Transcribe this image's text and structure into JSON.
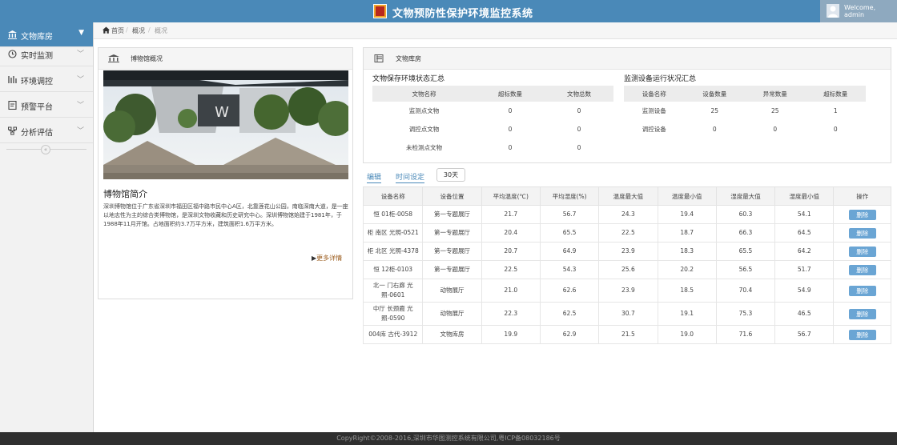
{
  "header": {
    "logo_icon": "museum-logo",
    "title": "文物预防性保护环境监控系统",
    "user_icon": "user-avatar-icon",
    "welcome": "Welcome,",
    "username": "admin"
  },
  "sidebar": {
    "items": [
      {
        "label": "文物库房",
        "icon": "bank-icon",
        "active": true
      },
      {
        "label": "实时监测",
        "icon": "clock-icon",
        "active": false
      },
      {
        "label": "环境调控",
        "icon": "bars-icon",
        "active": false
      },
      {
        "label": "预警平台",
        "icon": "document-icon",
        "active": false
      },
      {
        "label": "分析评估",
        "icon": "network-icon",
        "active": false
      }
    ]
  },
  "breadcrumb": {
    "home": "首页",
    "level1": "概况",
    "level2": "概况"
  },
  "museum_panel": {
    "title": "博物馆概况",
    "intro_title": "博物馆简介",
    "intro_text": "深圳博物馆位于广东省深圳市福田区福中路市民中心A区，北靠莲花山公园，南临深南大道，是一座以地志性为主的综合类博物馆，是深圳文物收藏和历史研究中心。深圳博物馆始建于1981年，于1988年11月开馆。占地面积约3.7万平方米，建筑面积1.6万平方米。",
    "more": "更多详情"
  },
  "storage_panel": {
    "title": "文物库房",
    "env_summary": {
      "title": "文物保存环境状态汇总",
      "headers": [
        "文物名称",
        "超标数量",
        "文物总数"
      ],
      "rows": [
        [
          "监测点文物",
          "0",
          "0"
        ],
        [
          "调控点文物",
          "0",
          "0"
        ],
        [
          "未检测点文物",
          "0",
          "0"
        ]
      ]
    },
    "device_summary": {
      "title": "监测设备运行状况汇总",
      "headers": [
        "设备名称",
        "设备数量",
        "异常数量",
        "超标数量"
      ],
      "rows": [
        [
          "监测设备",
          "25",
          "25",
          "1"
        ],
        [
          "调控设备",
          "0",
          "0",
          "0"
        ]
      ]
    }
  },
  "tabs": {
    "edit": "编辑",
    "time_setting": "时间设定",
    "days": "30天"
  },
  "devices_table": {
    "headers": [
      "设备名称",
      "设备位置",
      "平均温度(℃)",
      "平均湿度(%)",
      "温度最大值",
      "温度最小值",
      "湿度最大值",
      "湿度最小值",
      "操作"
    ],
    "delete_label": "删除",
    "rows": [
      [
        "恒 01柜-0058",
        "第一专题展厅",
        "21.7",
        "56.7",
        "24.3",
        "19.4",
        "60.3",
        "54.1"
      ],
      [
        "柜 南区 光照-0521",
        "第一专题展厅",
        "20.4",
        "65.5",
        "22.5",
        "18.7",
        "66.3",
        "64.5"
      ],
      [
        "柜 北区 光照-4378",
        "第一专题展厅",
        "20.7",
        "64.9",
        "23.9",
        "18.3",
        "65.5",
        "64.2"
      ],
      [
        "恒 12柜-0103",
        "第一专题展厅",
        "22.5",
        "54.3",
        "25.6",
        "20.2",
        "56.5",
        "51.7"
      ],
      [
        "北一 门右廊 光照-0601",
        "动物展厅",
        "21.0",
        "62.6",
        "23.9",
        "18.5",
        "70.4",
        "54.9"
      ],
      [
        "中厅 长颈鹿 光照-0590",
        "动物展厅",
        "22.3",
        "62.5",
        "30.7",
        "19.1",
        "75.3",
        "46.5"
      ],
      [
        "004库 古代-3912",
        "文物库房",
        "19.9",
        "62.9",
        "21.5",
        "19.0",
        "71.6",
        "56.7"
      ]
    ]
  },
  "footer": {
    "text": "CopyRight©2008-2016,深圳市华图测控系统有限公司,粤ICP备08032186号"
  }
}
